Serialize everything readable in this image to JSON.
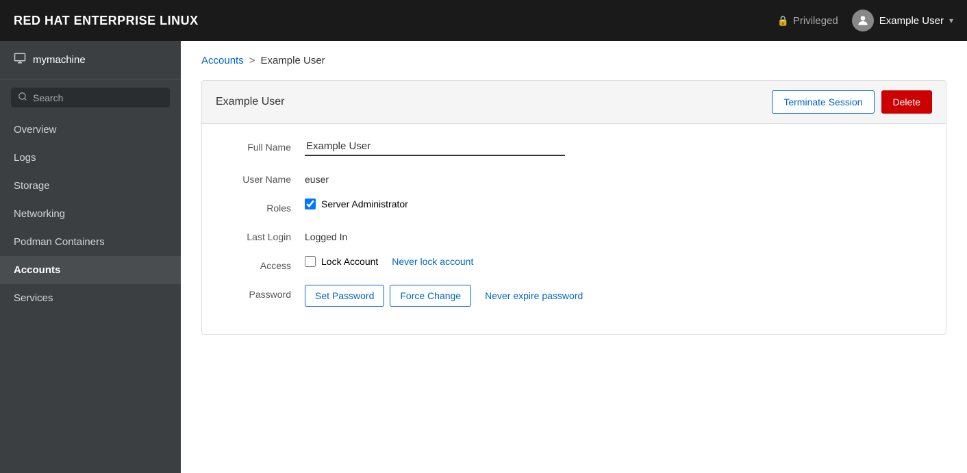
{
  "topbar": {
    "title": "RED HAT ENTERPRISE LINUX",
    "privileged_label": "Privileged",
    "user_label": "Example User"
  },
  "sidebar": {
    "machine_name": "mymachine",
    "search_placeholder": "Search",
    "nav_items": [
      {
        "id": "overview",
        "label": "Overview",
        "active": false
      },
      {
        "id": "logs",
        "label": "Logs",
        "active": false
      },
      {
        "id": "storage",
        "label": "Storage",
        "active": false
      },
      {
        "id": "networking",
        "label": "Networking",
        "active": false
      },
      {
        "id": "podman",
        "label": "Podman Containers",
        "active": false
      },
      {
        "id": "accounts",
        "label": "Accounts",
        "active": true
      },
      {
        "id": "services",
        "label": "Services",
        "active": false
      }
    ]
  },
  "breadcrumb": {
    "parent_label": "Accounts",
    "separator": ">",
    "current_label": "Example User"
  },
  "user_detail": {
    "card_title": "Example User",
    "terminate_session_label": "Terminate Session",
    "delete_label": "Delete",
    "full_name_label": "Full Name",
    "full_name_value": "Example User",
    "username_label": "User Name",
    "username_value": "euser",
    "roles_label": "Roles",
    "roles_value": "Server Administrator",
    "roles_checked": true,
    "last_login_label": "Last Login",
    "last_login_value": "Logged In",
    "access_label": "Access",
    "lock_account_label": "Lock Account",
    "lock_checked": false,
    "never_lock_label": "Never lock account",
    "password_label": "Password",
    "set_password_label": "Set Password",
    "force_change_label": "Force Change",
    "never_expire_label": "Never expire password"
  },
  "icons": {
    "lock": "🔒",
    "machine": "☰",
    "search": "🔍",
    "avatar": "👤",
    "chevron_down": "▾"
  }
}
